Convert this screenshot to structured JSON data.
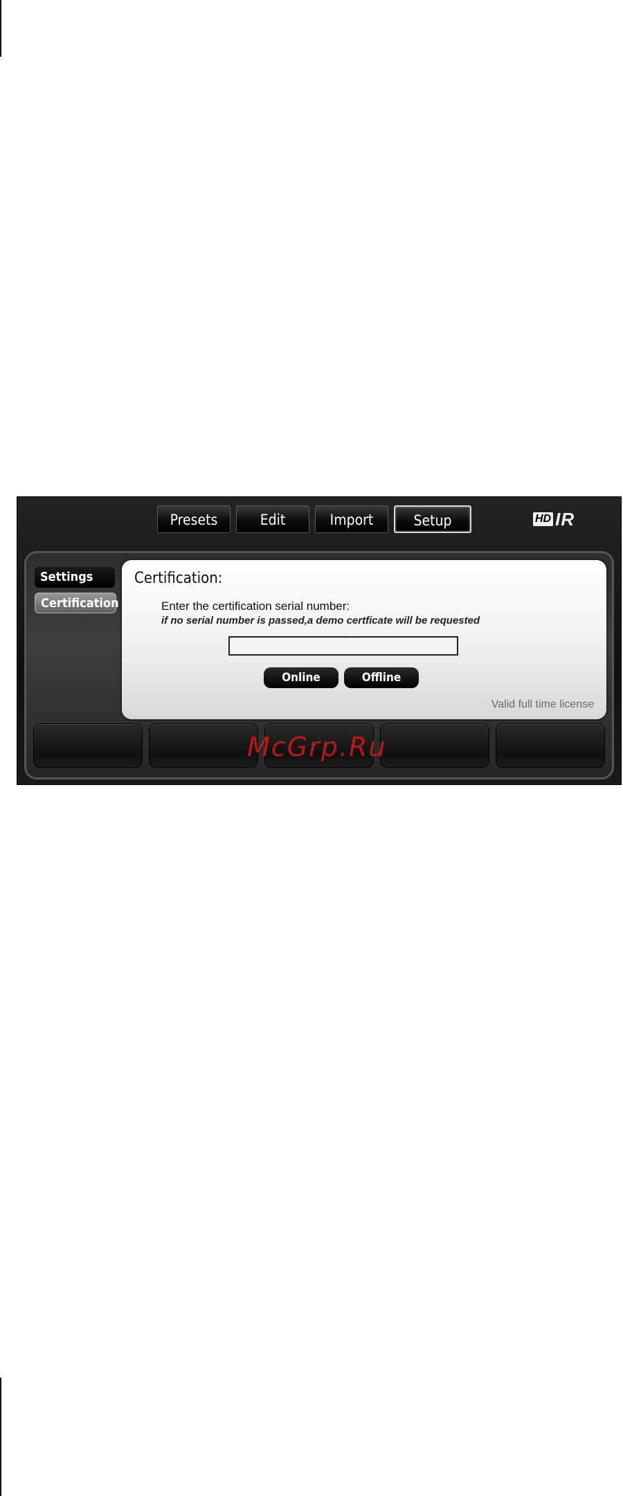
{
  "tabs": [
    {
      "label": "Presets"
    },
    {
      "label": "Edit"
    },
    {
      "label": "Import"
    },
    {
      "label": "Setup",
      "active": true
    }
  ],
  "brand": {
    "hd": "HD",
    "suffix": "IR"
  },
  "sidebar": {
    "items": [
      {
        "label": "Settings"
      },
      {
        "label": "Certification",
        "active": true
      }
    ]
  },
  "certification": {
    "title": "Certification:",
    "instruction": "Enter the certification serial number:",
    "hint": "if no serial number is passed,a demo certficate will be requested",
    "serial_value": "",
    "online_label": "Online",
    "offline_label": "Offline",
    "status": "Valid full time license"
  },
  "watermark": "McGrp.Ru",
  "colors": {
    "watermark": "#d81818",
    "background": "#ffffff",
    "plugin_bg": "#121212"
  }
}
